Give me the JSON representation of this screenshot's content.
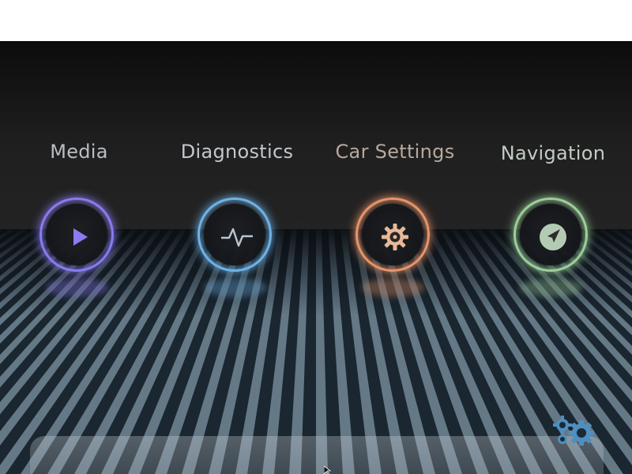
{
  "apps": [
    {
      "label": "Media",
      "icon": "play-icon",
      "color": "#8a7bf0",
      "label_color": "#b9bec6"
    },
    {
      "label": "Diagnostics",
      "icon": "pulse-icon",
      "color": "#6fb3e8",
      "label_color": "#c3c8ce"
    },
    {
      "label": "Car Settings",
      "icon": "gear-icon",
      "color": "#e8946a",
      "label_color": "#b9a89e"
    },
    {
      "label": "Navigation",
      "icon": "compass-icon",
      "color": "#9ccf9a",
      "label_color": "#c3cbc4"
    }
  ],
  "settings_icon": "settings-gears-icon",
  "settings_color": "#4f8fbf"
}
